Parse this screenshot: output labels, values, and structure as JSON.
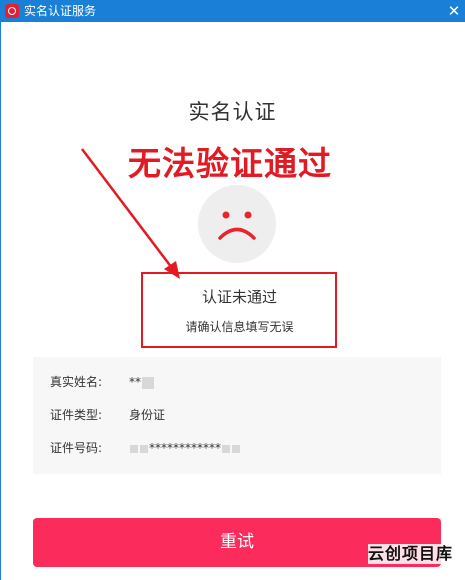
{
  "window": {
    "title": "实名认证服务",
    "close_glyph": "✕"
  },
  "page": {
    "title": "实名认证"
  },
  "annotation": {
    "text": "无法验证通过",
    "color": "#e21a23"
  },
  "result": {
    "title": "认证未通过",
    "subtitle": "请确认信息填写无误"
  },
  "info": {
    "rows": [
      {
        "label": "真实姓名:",
        "value": "**"
      },
      {
        "label": "证件类型:",
        "value": "身份证"
      },
      {
        "label": "证件号码:",
        "value": "************"
      }
    ]
  },
  "actions": {
    "retry_label": "重试"
  },
  "watermark": {
    "text": "云创项目库"
  },
  "colors": {
    "titlebar": "#1a7fd6",
    "accent_button": "#fb2c5c",
    "highlight": "#e21a23"
  }
}
